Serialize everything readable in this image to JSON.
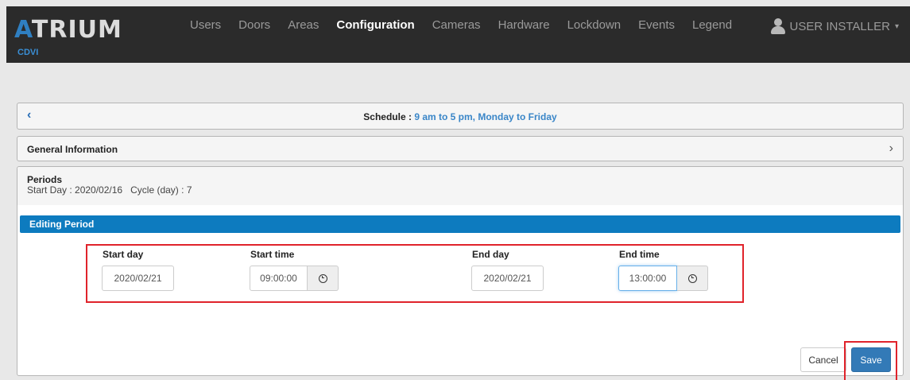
{
  "app": {
    "logo_text_a": "A",
    "logo_text_rest": "TRIUM",
    "logo_sub": "CDVI"
  },
  "nav": {
    "items": [
      {
        "label": "Users"
      },
      {
        "label": "Doors"
      },
      {
        "label": "Areas"
      },
      {
        "label": "Configuration",
        "active": true
      },
      {
        "label": "Cameras"
      },
      {
        "label": "Hardware"
      },
      {
        "label": "Lockdown"
      },
      {
        "label": "Events"
      },
      {
        "label": "Legend"
      }
    ],
    "user_label": "USER INSTALLER",
    "caret": "▾"
  },
  "schedule": {
    "back_icon": "‹",
    "label": "Schedule :",
    "value": "9 am to 5 pm, Monday to Friday"
  },
  "general": {
    "title": "General Information",
    "chevron": "›"
  },
  "periods": {
    "title": "Periods",
    "start_day_label": "Start Day :",
    "start_day_value": "2020/02/16",
    "cycle_label": "Cycle (day) :",
    "cycle_value": "7"
  },
  "editing": {
    "title": "Editing Period",
    "start_day_label": "Start day",
    "start_day_value": "2020/02/21",
    "start_time_label": "Start time",
    "start_time_value": "09:00:00",
    "end_day_label": "End day",
    "end_day_value": "2020/02/21",
    "end_time_label": "End time",
    "end_time_value": "13:00:00"
  },
  "actions": {
    "cancel_label": "Cancel",
    "save_label": "Save"
  },
  "colors": {
    "navbar": "#2b2b2b",
    "accent": "#0d7bbf",
    "save": "#337ab7",
    "highlight": "#e0232b"
  }
}
